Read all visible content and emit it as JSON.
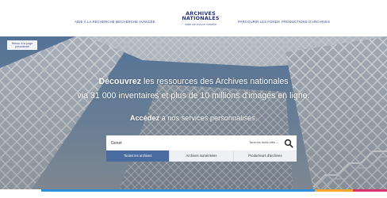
{
  "nav": {
    "left": [
      {
        "label": "Aide à la recherche"
      },
      {
        "label": "Recherche avancée"
      }
    ],
    "right": [
      {
        "label": "Parcourir les fonds"
      },
      {
        "label": "Productions d'archives"
      }
    ]
  },
  "logo": {
    "line1": "Archives",
    "line2": "nationales",
    "subtitle": "Salle de lecture virtuelle"
  },
  "hero": {
    "back_label_line1": "Retour à la page",
    "back_label_line2": "précédente",
    "line1_bold": "Découvrez",
    "line1_rest": " les ressources des Archives nationales",
    "line2": "via 31 000 inventaires et plus de 10 millions d'images en ligne.",
    "line3_bold": "Accédez",
    "line3_rest": " à nos services personnalisés."
  },
  "search": {
    "value": "Genet",
    "scope_label": "Tous les mots-clés",
    "tabs": [
      {
        "label": "Toutes les archives",
        "active": true
      },
      {
        "label": "Archives numérisées",
        "active": false
      },
      {
        "label": "Producteurs d'archives",
        "active": false
      }
    ]
  },
  "colors": {
    "brand": "#27317a",
    "tab_active": "#4a6b9e"
  }
}
